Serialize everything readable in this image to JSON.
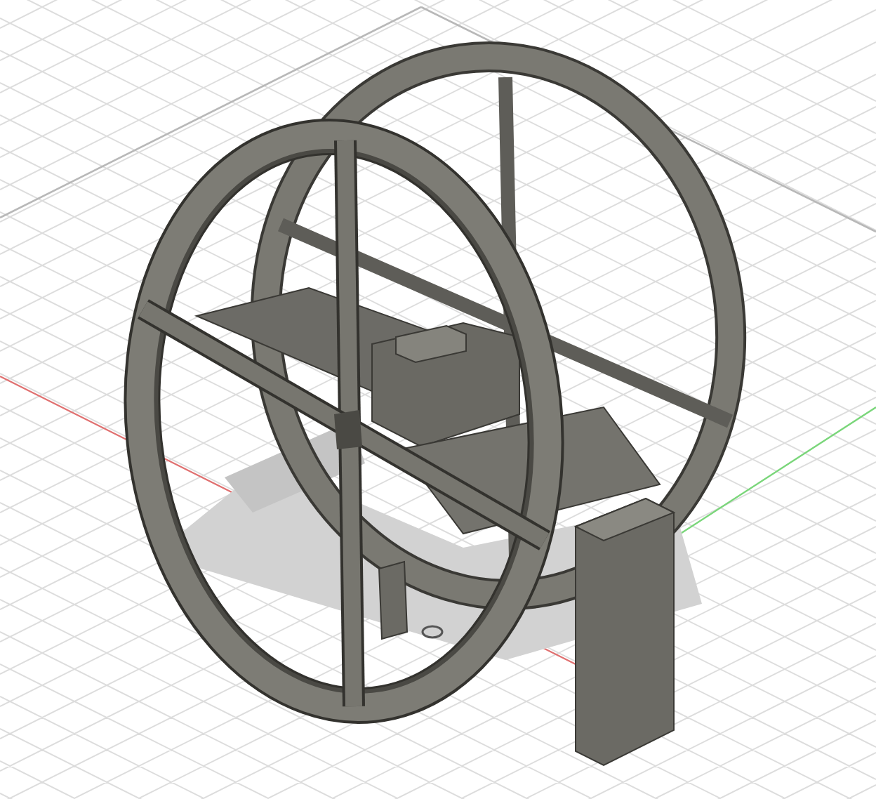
{
  "viewport": {
    "kind": "cad-3d",
    "grid": true,
    "axes": true
  }
}
